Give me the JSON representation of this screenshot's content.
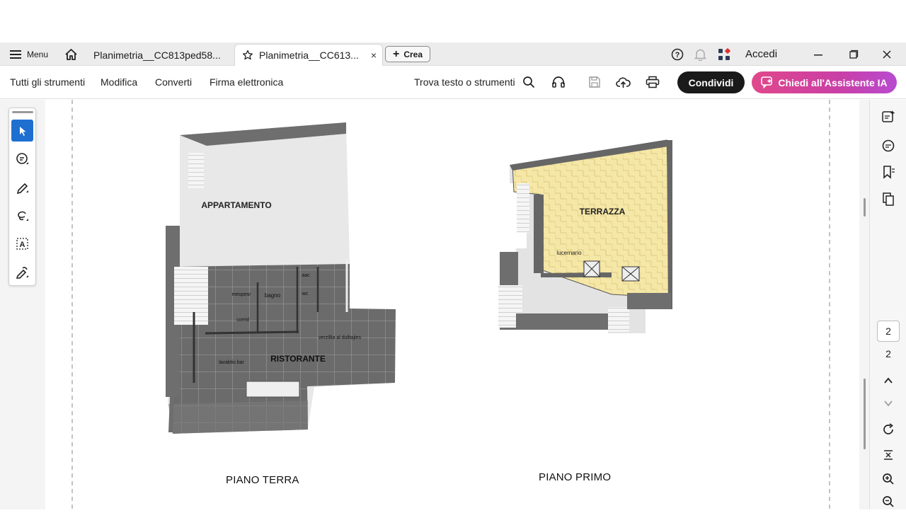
{
  "titlebar": {
    "menu_label": "Menu",
    "tabs": [
      {
        "label": "Planimetria__CC813ped58..."
      },
      {
        "label": "Planimetria__CC613...",
        "close": "×"
      }
    ],
    "create_label": "Crea",
    "signin_label": "Accedi"
  },
  "toolbar": {
    "items": [
      "Tutti gli strumenti",
      "Modifica",
      "Converti",
      "Firma elettronica"
    ],
    "search_label": "Trova testo o strumenti",
    "share_label": "Condividi",
    "ai_label": "Chiedi all'Assistente IA"
  },
  "page_nav": {
    "current": "2",
    "total": "2"
  },
  "floorplan": {
    "ground": {
      "caption": "PIANO TERRA",
      "rooms": [
        "APPARTAMENTO",
        "RISTORANTE",
        "bagno",
        "mespesr",
        "corrid",
        "lavabtis bar",
        "verzillia al dulitajies",
        "aac",
        "wc"
      ]
    },
    "first": {
      "caption": "PIANO PRIMO",
      "rooms": [
        "TERRAZZA",
        "lucernario"
      ]
    }
  },
  "colors": {
    "terrace": "#f5e7a6",
    "accent_blue": "#1f6fd1",
    "ai_gradient_start": "#e0488b",
    "ai_gradient_end": "#b84bd0"
  },
  "icons": [
    "hamburger-icon",
    "home-icon",
    "star-icon",
    "help-icon",
    "bell-icon",
    "apps-icon",
    "minimize-icon",
    "maximize-icon",
    "close-icon",
    "search-icon",
    "headphones-icon",
    "save-icon",
    "cloud-upload-icon",
    "print-icon",
    "select-cursor-icon",
    "comment-icon",
    "highlight-pen-icon",
    "lasso-icon",
    "text-box-icon",
    "sign-icon",
    "ai-summary-icon",
    "chat-icon",
    "bookmark-icon",
    "pages-icon",
    "rotate-icon",
    "fit-page-icon",
    "zoom-in-icon",
    "zoom-out-icon",
    "chevron-up-icon",
    "chevron-down-icon"
  ]
}
